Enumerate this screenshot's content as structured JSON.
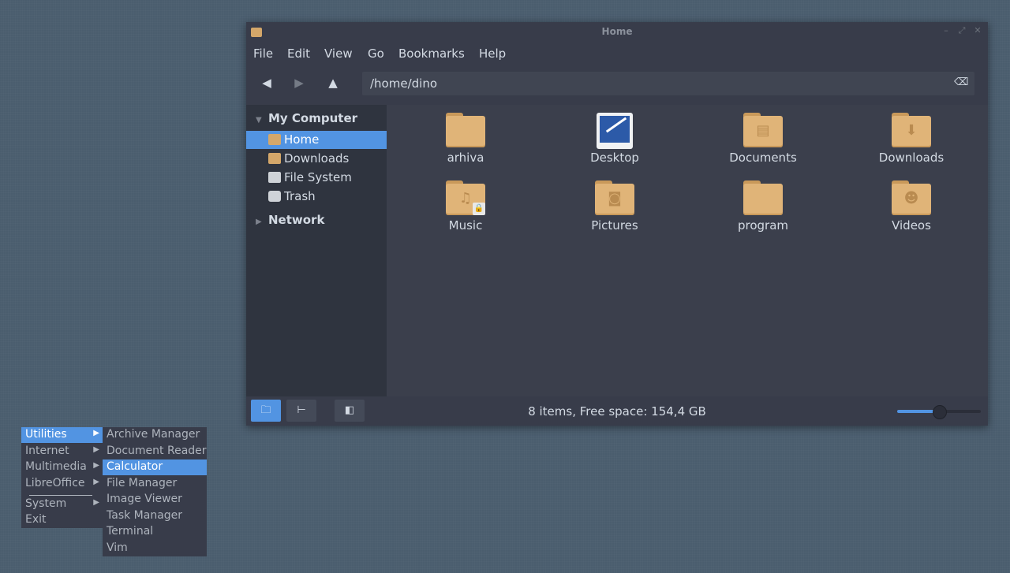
{
  "window": {
    "title": "Home",
    "menu": [
      "File",
      "Edit",
      "View",
      "Go",
      "Bookmarks",
      "Help"
    ],
    "path": "/home/dino"
  },
  "sidebar": {
    "my_computer": "My Computer",
    "items": [
      {
        "label": "Home",
        "icon": "home-folder-icon",
        "selected": true
      },
      {
        "label": "Downloads",
        "icon": "downloads-folder-icon"
      },
      {
        "label": "File System",
        "icon": "drive-icon"
      },
      {
        "label": "Trash",
        "icon": "trash-icon"
      }
    ],
    "network": "Network"
  },
  "files": [
    {
      "name": "arhiva",
      "icon": "folder-icon"
    },
    {
      "name": "Desktop",
      "icon": "desktop-icon"
    },
    {
      "name": "Documents",
      "icon": "documents-folder-icon"
    },
    {
      "name": "Downloads",
      "icon": "downloads-folder-icon"
    },
    {
      "name": "Music",
      "icon": "music-folder-icon"
    },
    {
      "name": "Pictures",
      "icon": "pictures-folder-icon"
    },
    {
      "name": "program",
      "icon": "folder-icon"
    },
    {
      "name": "Videos",
      "icon": "videos-folder-icon"
    }
  ],
  "status": {
    "text": "8 items, Free space: 154,4 GB",
    "zoom_level": 0.5
  },
  "start_menu": {
    "categories": [
      {
        "label": "Utilities",
        "has_sub": true,
        "selected": true
      },
      {
        "label": "Internet",
        "has_sub": true
      },
      {
        "label": "Multimedia",
        "has_sub": true
      },
      {
        "label": "LibreOffice",
        "has_sub": true
      },
      {
        "label": "System",
        "has_sub": true
      },
      {
        "label": "Exit",
        "has_sub": false
      }
    ],
    "utilities": [
      {
        "label": "Archive Manager"
      },
      {
        "label": "Document Reader"
      },
      {
        "label": "Calculator",
        "selected": true
      },
      {
        "label": "File Manager"
      },
      {
        "label": "Image Viewer"
      },
      {
        "label": "Task Manager"
      },
      {
        "label": "Terminal"
      },
      {
        "label": "Vim"
      }
    ]
  },
  "colors": {
    "accent": "#5294e2",
    "window_bg": "#383c4a",
    "folder": "#e0b478"
  }
}
